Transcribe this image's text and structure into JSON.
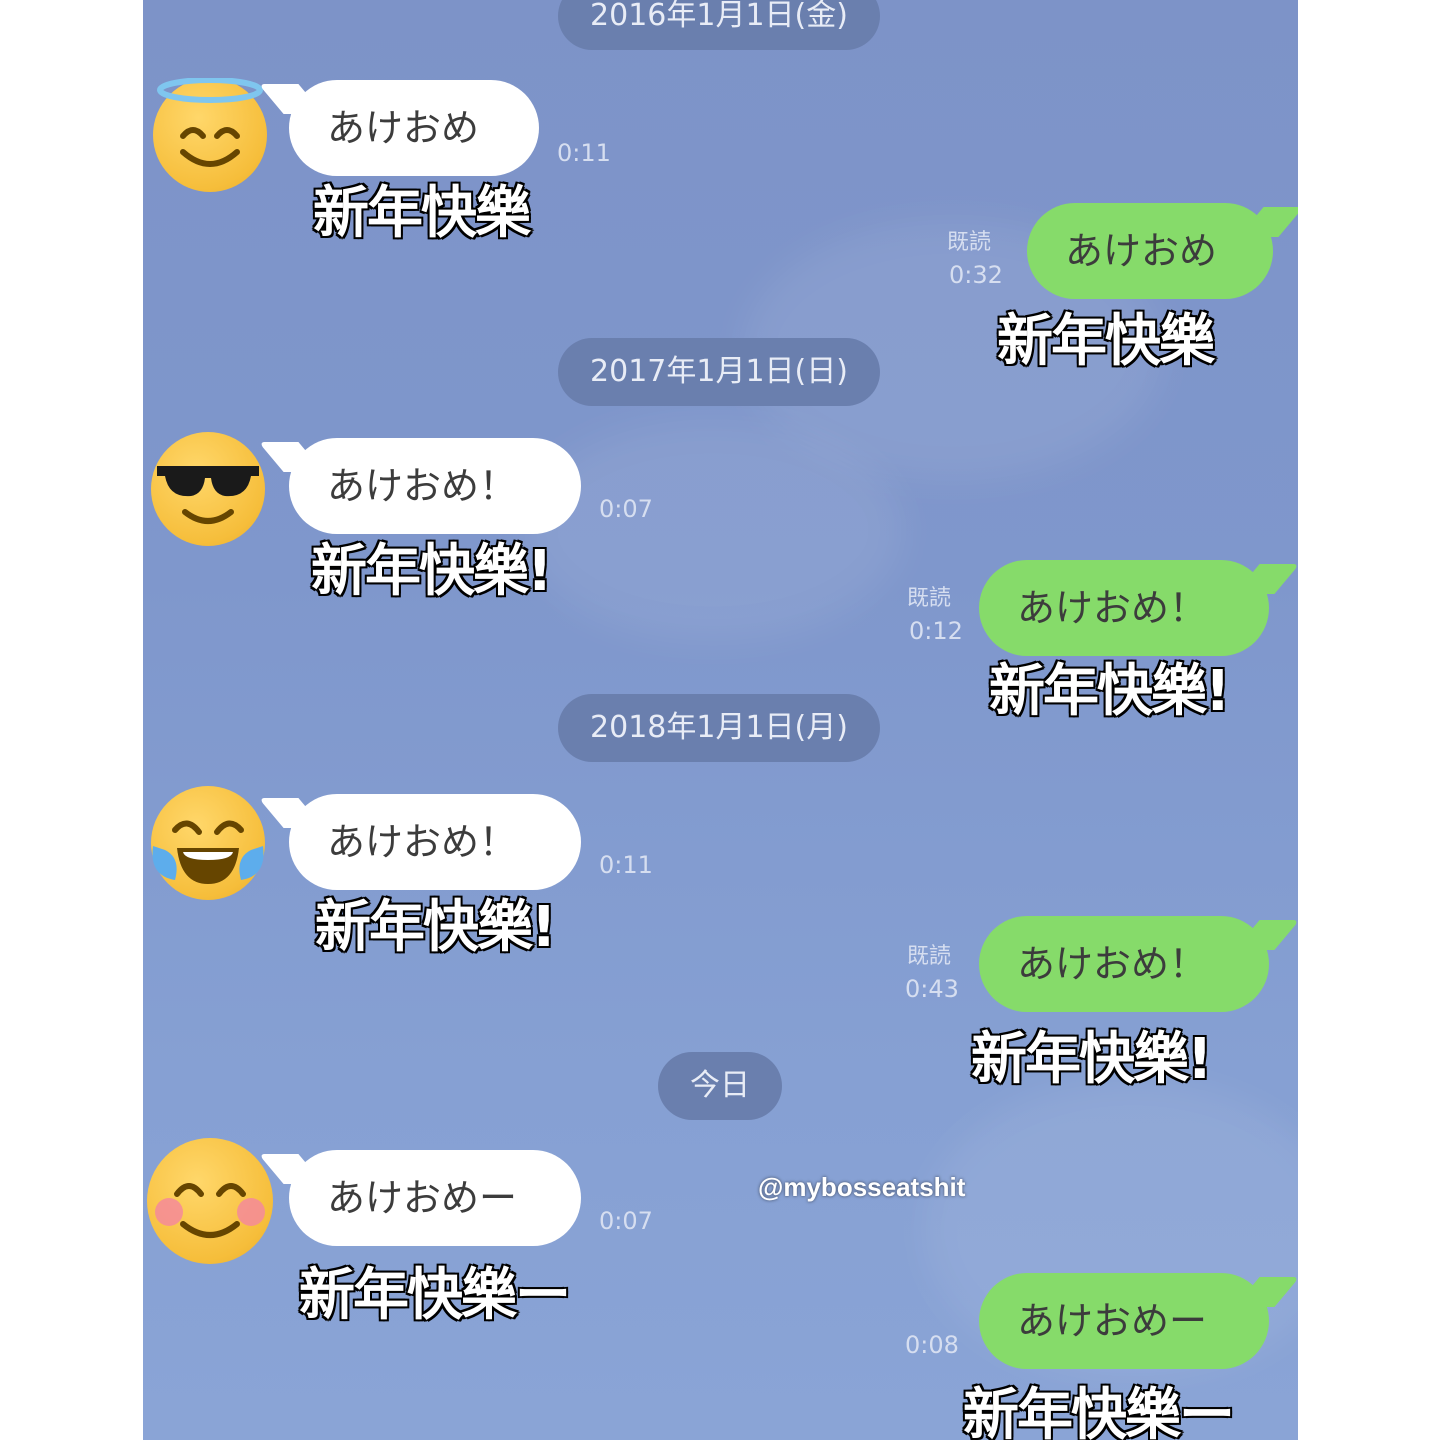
{
  "dates": [
    "2016年1月1日(金)",
    "2017年1月1日(日)",
    "2018年1月1日(月)",
    "今日"
  ],
  "read_label": "既読",
  "messages": [
    {
      "side": "in",
      "avatar": "halo-smile-emoji-icon",
      "text": "あけおめ",
      "time": "0:11",
      "sub": "新年快樂"
    },
    {
      "side": "out",
      "text": "あけおめ",
      "time": "0:32",
      "sub": "新年快樂"
    },
    {
      "side": "in",
      "avatar": "sunglasses-emoji-icon",
      "text": "あけおめ！",
      "time": "0:07",
      "sub": "新年快樂!"
    },
    {
      "side": "out",
      "text": "あけおめ！",
      "time": "0:12",
      "sub": "新年快樂!"
    },
    {
      "side": "in",
      "avatar": "tears-of-joy-emoji-icon",
      "text": "あけおめ！",
      "time": "0:11",
      "sub": "新年快樂!"
    },
    {
      "side": "out",
      "text": "あけおめ！",
      "time": "0:43",
      "sub": "新年快樂!"
    },
    {
      "side": "in",
      "avatar": "blushing-smile-emoji-icon",
      "text": "あけおめー",
      "time": "0:07",
      "sub": "新年快樂ー"
    },
    {
      "side": "out",
      "text": "あけおめー",
      "time": "0:08",
      "sub": "新年快樂ー"
    }
  ],
  "watermark": "@mybosseatshit",
  "colors": {
    "background": "#7f97cc",
    "date_pill": "#6a7fae",
    "incoming_bubble": "#ffffff",
    "outgoing_bubble": "#86db6a"
  }
}
